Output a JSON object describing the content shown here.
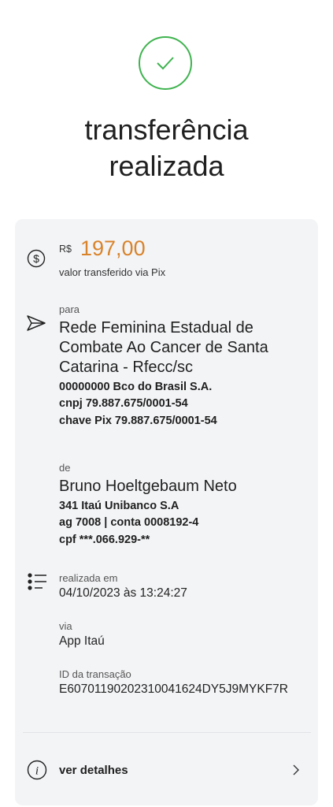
{
  "header": {
    "title_line1": "transferência",
    "title_line2": "realizada"
  },
  "amount": {
    "currency": "R$",
    "value": "197,00",
    "caption": "valor transferido via Pix"
  },
  "recipient": {
    "label": "para",
    "name_line1": "Rede Feminina Estadual de",
    "name_line2": "Combate Ao Cancer de Santa",
    "name_line3": "Catarina - Rfecc/sc",
    "bank": "00000000 Bco do Brasil S.A.",
    "cnpj": "cnpj 79.887.675/0001-54",
    "pix_key": "chave Pix 79.887.675/0001-54"
  },
  "sender": {
    "label": "de",
    "name": "Bruno Hoeltgebaum Neto",
    "bank": "341 Itaú Unibanco S.A",
    "account": "ag 7008 | conta 0008192-4",
    "cpf": "cpf ***.066.929-**"
  },
  "info": {
    "date_label": "realizada em",
    "date_value": "04/10/2023 às 13:24:27",
    "via_label": "via",
    "via_value": "App Itaú",
    "id_label": "ID da transação",
    "id_value": "E60701190202310041624DY5J9MYKF7R"
  },
  "details": {
    "label": "ver detalhes"
  },
  "colors": {
    "success": "#3fb34f",
    "amount": "#d9832a",
    "card": "#f3f4f6"
  }
}
